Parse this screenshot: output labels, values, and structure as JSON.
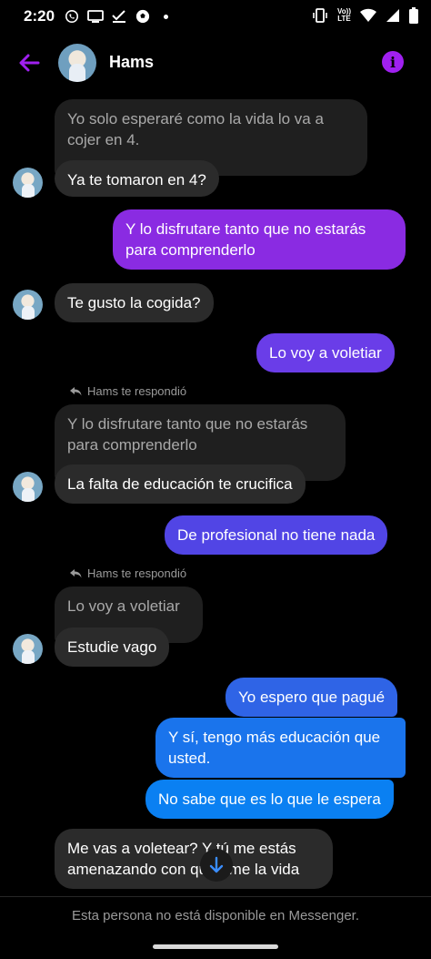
{
  "status_bar": {
    "time": "2:20",
    "lte_top": "Vo))",
    "lte_bottom": "LTE"
  },
  "header": {
    "contact_name": "Hams",
    "accent": "#a020f0"
  },
  "messages": {
    "m1_quoted": "Yo solo esperaré como la vida lo va a cojer en 4.",
    "m1_reply": "Ya te tomaron en 4?",
    "m2_out": "Y lo disfrutare tanto que no estarás para comprenderlo",
    "m3_in": "Te gusto la cogida?",
    "m4_out": "Lo voy a voletiar",
    "m5_note": "Hams te respondió",
    "m5_quoted": "Y lo disfrutare tanto que no estarás para comprenderlo",
    "m5_reply": "La falta de educación te crucifica",
    "m6_out": "De profesional no tiene nada",
    "m7_note": "Hams te respondió",
    "m7_quoted": "Lo voy a voletiar",
    "m7_reply": "Estudie vago",
    "m8_out": "Yo espero que pagué",
    "m9_out": "Y sí, tengo más educación que usted.",
    "m10_out": "No sabe que es lo que le espera",
    "m11_in": "Me vas a voletear? Y tú me estás amenazando con quitarme la vida"
  },
  "footer": {
    "notice": "Esta persona no está disponible en Messenger."
  }
}
